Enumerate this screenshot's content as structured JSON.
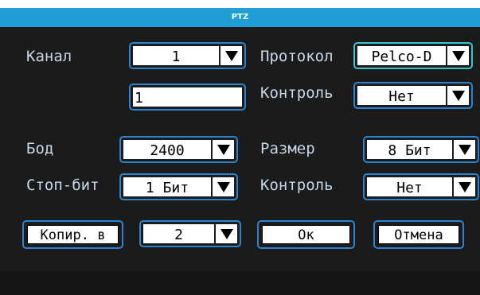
{
  "title": "PTZ",
  "fields": {
    "channel": {
      "label": "Канал",
      "value": "1"
    },
    "protocol": {
      "label": "Протокол",
      "value": "Pelco-D"
    },
    "address": {
      "value": "1"
    },
    "control1": {
      "label": "Контроль",
      "value": "Нет"
    },
    "baud": {
      "label": "Бод",
      "value": "2400"
    },
    "size": {
      "label": "Размер",
      "value": "8 Бит"
    },
    "stopbit": {
      "label": "Стоп-бит",
      "value": "1 Бит"
    },
    "control2": {
      "label": "Контроль",
      "value": "Нет"
    },
    "copy_to": {
      "label": "Копир. в",
      "value": "2"
    }
  },
  "buttons": {
    "ok": "Ок",
    "cancel": "Отмена"
  },
  "colors": {
    "accent": "#1f9fd6",
    "border": "#2a84d0",
    "focus": "#36c6d6",
    "background": "#1b1b1b"
  },
  "icons": {
    "dropdown": "dropdown-arrow-icon"
  }
}
